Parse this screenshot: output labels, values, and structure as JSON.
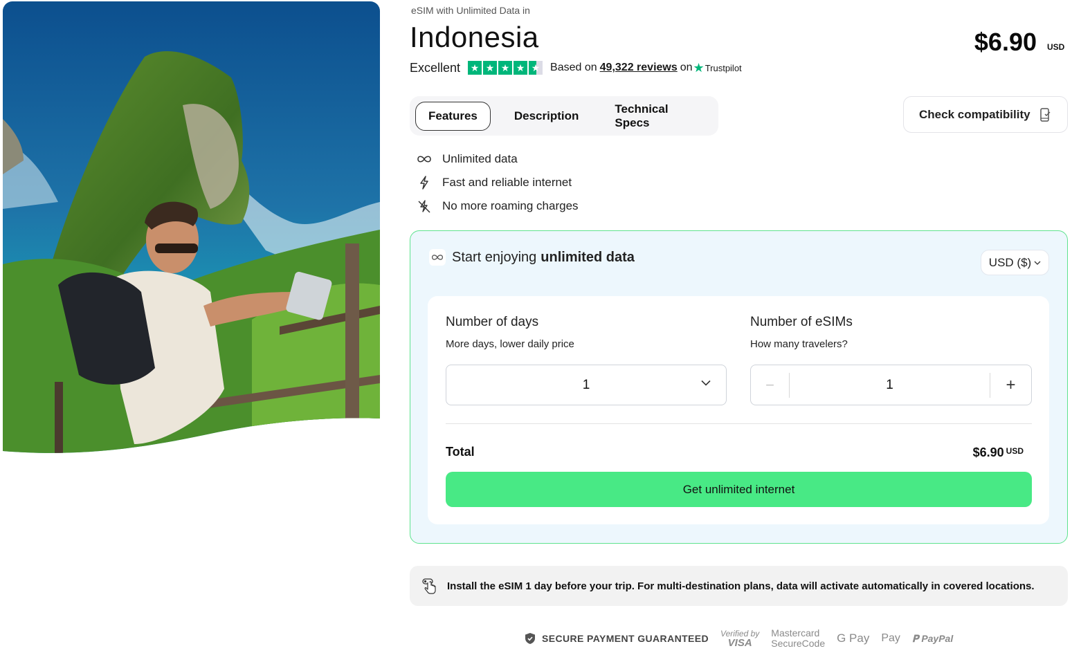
{
  "hero": {
    "alt": "Traveler taking a selfie on a cliff stairway above Kelingking Beach, Indonesia"
  },
  "header": {
    "subtitle": "eSIM with Unlimited Data in",
    "title": "Indonesia",
    "price": "$6.90",
    "price_currency": "USD"
  },
  "rating": {
    "label": "Excellent",
    "stars": 4.5,
    "based_on": "Based on",
    "reviews": "49,322 reviews",
    "on": "on",
    "provider": "Trustpilot"
  },
  "tabs": [
    {
      "label": "Features",
      "active": true
    },
    {
      "label": "Description",
      "active": false
    },
    {
      "label": "Technical Specs",
      "active": false
    }
  ],
  "check_compatibility": {
    "label": "Check compatibility",
    "icon": "phone-check-icon"
  },
  "features": [
    {
      "icon": "infinity-icon",
      "label": "Unlimited data"
    },
    {
      "icon": "lightning-icon",
      "label": "Fast and reliable internet"
    },
    {
      "icon": "no-roaming-icon",
      "label": "No more roaming charges"
    }
  ],
  "panel": {
    "heading_prefix": "Start enjoying",
    "heading_bold": "unlimited data",
    "currency_select": "USD ($)",
    "days": {
      "title": "Number of days",
      "subtitle": "More days, lower daily price",
      "value": "1"
    },
    "esims": {
      "title": "Number of eSIMs",
      "subtitle": "How many travelers?",
      "value": "1",
      "minus": "−",
      "plus": "+"
    },
    "total_label": "Total",
    "total_value": "$6.90",
    "total_currency": "USD",
    "cta": "Get unlimited internet"
  },
  "note": {
    "icon": "tap-hand-icon",
    "text": "Install the eSIM 1 day before your trip. For multi-destination plans, data will activate automatically in covered locations."
  },
  "payments": {
    "secure_label": "SECURE PAYMENT GUARANTEED",
    "visa_line1": "Verified by",
    "visa_line2": "VISA",
    "mastercard_line1": "Mastercard",
    "mastercard_line2": "SecureCode",
    "gpay": "G Pay",
    "applepay": "Pay",
    "paypal": "PayPal"
  },
  "colors": {
    "brand_green": "#48e985",
    "panel_border": "#5ee38e",
    "panel_bg": "#edf7fd",
    "trustpilot_green": "#00b67a"
  }
}
